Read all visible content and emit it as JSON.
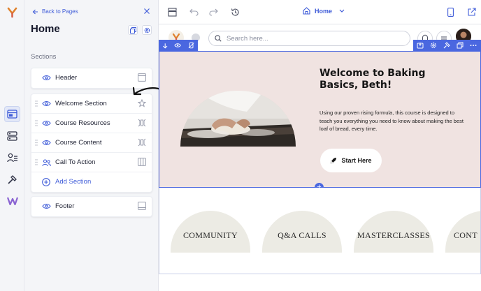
{
  "panel": {
    "back_label": "Back to Pages",
    "page_title": "Home",
    "sections_heading": "Sections"
  },
  "sections": {
    "header": "Header",
    "middle": [
      {
        "label": "Welcome Section",
        "icon": "star-icon"
      },
      {
        "label": "Course Resources",
        "icon": "columns-icon"
      },
      {
        "label": "Course Content",
        "icon": "columns-icon"
      },
      {
        "label": "Call To Action",
        "icon": "grid-icon"
      }
    ],
    "add_section": "Add Section",
    "footer": "Footer"
  },
  "toolbar": {
    "page_selector": "Home"
  },
  "site": {
    "search_placeholder": "Search here...",
    "hero_title": "Welcome to Baking Basics, Beth!",
    "hero_text": "Using our proven rising formula, this course is designed to teach you everything you need to know about making the best loaf of bread, every time.",
    "start_button": "Start Here",
    "features": [
      "COMMUNITY",
      "Q&A CALLS",
      "MASTERCLASSES",
      "CONT"
    ]
  },
  "colors": {
    "accent": "#4a67e0",
    "hero_bg": "#f0e3e1",
    "arch_bg": "#ecebe4"
  }
}
